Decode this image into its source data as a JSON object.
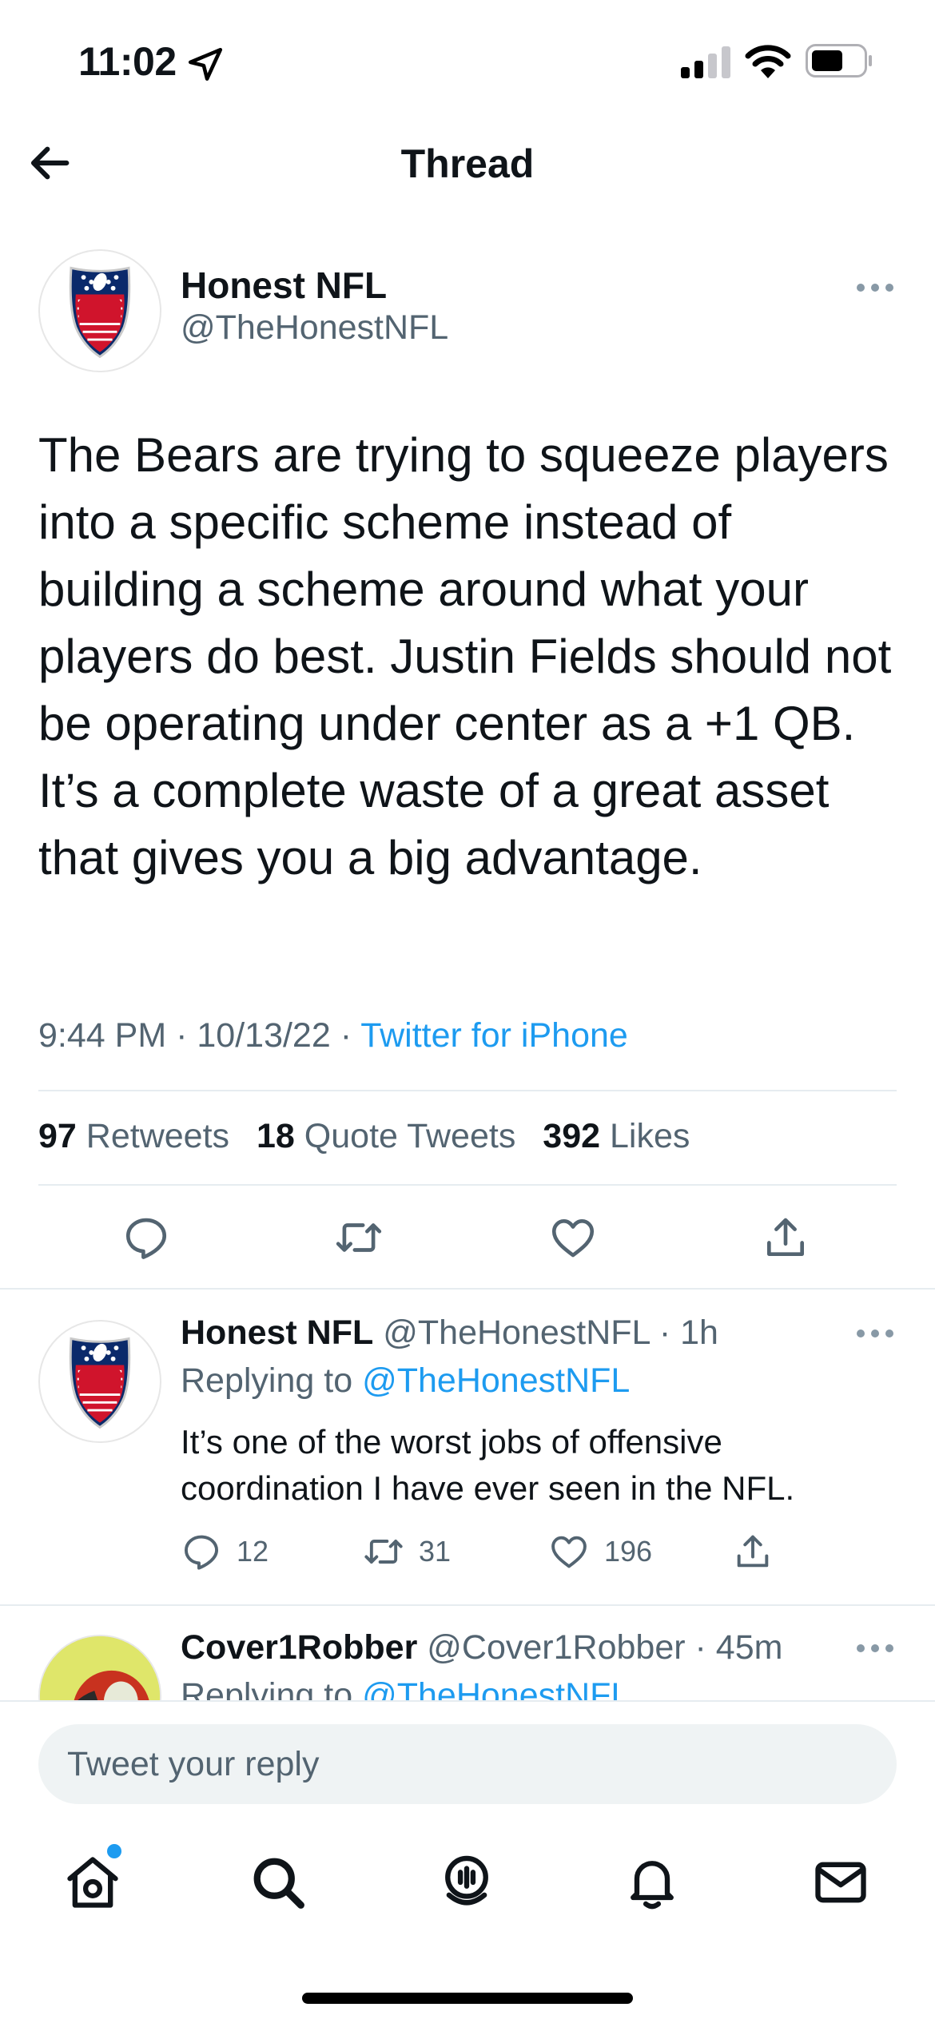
{
  "status_bar": {
    "time": "11:02"
  },
  "header": {
    "title": "Thread"
  },
  "main_tweet": {
    "author": {
      "name": "Honest NFL",
      "handle": "@TheHonestNFL"
    },
    "text": "The Bears are trying to squeeze players into a specific scheme instead of building a scheme around what your players do best. Justin Fields should not be operating under center as a +1 QB. It’s a complete waste of a great asset that gives you a big advantage.",
    "time": "9:44 PM",
    "date": "10/13/22",
    "source": "Twitter for iPhone",
    "stats": {
      "retweets": "97",
      "retweets_label": "Retweets",
      "quotes": "18",
      "quotes_label": "Quote Tweets",
      "likes": "392",
      "likes_label": "Likes"
    }
  },
  "replies": [
    {
      "name": "Honest NFL",
      "handle": "@TheHonestNFL",
      "age": "1h",
      "replying_prefix": "Replying to",
      "replying_to": "@TheHonestNFL",
      "text": "It’s one of the worst jobs of offensive coordination I have ever seen in the NFL.",
      "reply_count": "12",
      "retweet_count": "31",
      "like_count": "196"
    },
    {
      "name": "Cover1Robber",
      "handle": "@Cover1Robber",
      "age": "45m",
      "replying_prefix": "Replying to",
      "replying_to": "@TheHonestNFL"
    }
  ],
  "reply_bar": {
    "placeholder": "Tweet your reply"
  },
  "colors": {
    "accent": "#1d9bf0",
    "muted": "#536471",
    "text": "#0f1419",
    "divider": "#e6ecf0"
  },
  "icons": [
    "location-arrow-icon",
    "signal-icon",
    "wifi-icon",
    "battery-icon",
    "back-arrow-icon",
    "more-icon",
    "reply-icon",
    "retweet-icon",
    "like-icon",
    "share-icon",
    "home-icon",
    "search-icon",
    "spaces-icon",
    "notifications-icon",
    "messages-icon"
  ]
}
